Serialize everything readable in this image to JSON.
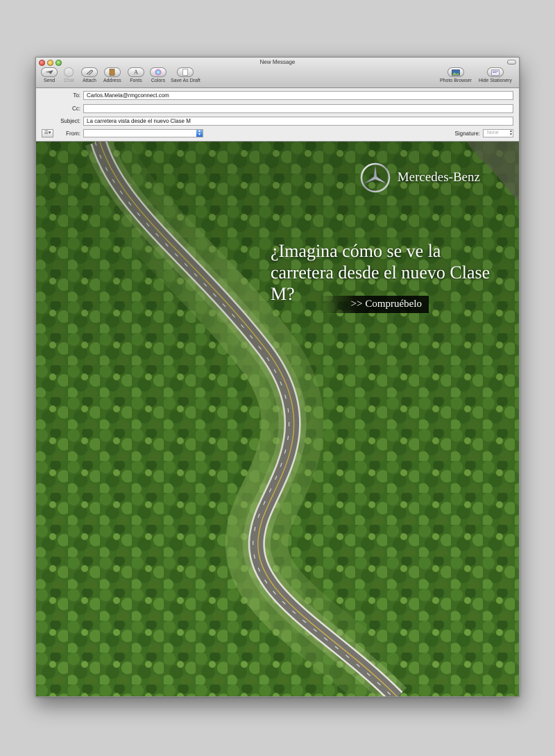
{
  "window": {
    "title": "New Message"
  },
  "toolbar": {
    "send": "Send",
    "chat": "Chat",
    "attach": "Attach",
    "address": "Address",
    "fonts": "Fonts",
    "colors": "Colors",
    "save_draft": "Save As Draft",
    "photo_browser": "Photo Browser",
    "hide_stationery": "Hide Stationery"
  },
  "header": {
    "to_label": "To:",
    "to_value": "Carlos.Manela@rmgconnect.com",
    "cc_label": "Cc:",
    "cc_value": "",
    "subject_label": "Subject:",
    "subject_value": "La carretera vista desde el nuevo Clase M",
    "from_label": "From:",
    "from_value": "",
    "signature_label": "Signature:",
    "signature_value": "None"
  },
  "body": {
    "brand_name": "Mercedes-Benz",
    "headline": "¿Imagina cómo se ve la carretera desde el nuevo Clase M?",
    "cta_label": ">> Compruébelo"
  }
}
